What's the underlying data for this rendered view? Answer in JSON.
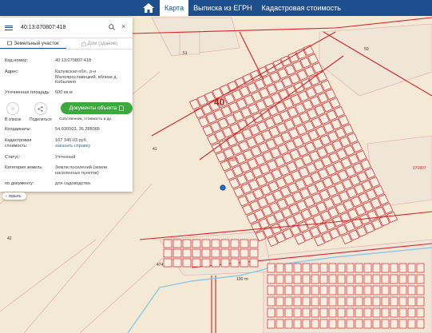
{
  "nav": {
    "items": [
      {
        "label": "Карта",
        "active": true
      },
      {
        "label": "Выписка из ЕГРН",
        "active": false
      },
      {
        "label": "Кадастровая стоимость",
        "active": false
      }
    ]
  },
  "search": {
    "value": "40:13:070807:418"
  },
  "tabs": [
    {
      "label": "Земельный участок",
      "active": true
    },
    {
      "label": "Дом (здание)",
      "active": false
    }
  ],
  "details": {
    "cad_number_label": "Кад.номер:",
    "cad_number_value": "40:13:070807:418",
    "address_label": "Адрес:",
    "address_line1": "Калужская обл., р-н",
    "address_line2": "Малоярославецкий, вблизи д.",
    "address_line3": "Кобылино",
    "area_label": "Уточненная площадь:",
    "area_value": "600 кв.м",
    "coords_label": "Координаты:",
    "coords_value": "54.930503, 36.288065",
    "cost_label1": "Кадастровая",
    "cost_label2": "стоимость:",
    "cost_value": "107 340.03 руб.",
    "cost_link": "заказать справку",
    "status_label": "Статус:",
    "status_value": "Учтенный",
    "category_label": "Категория земель:",
    "category_line1": "Земли поселений (земли",
    "category_line2": "населенных пунктов)",
    "usage_label": "по документу:",
    "usage_value": "для садоводства"
  },
  "actions": {
    "favorite": "В список",
    "share": "Поделиться",
    "doc_button": "Документы объекта",
    "doc_sub": "Собственник, стоимость и др."
  },
  "hide_button": "скрыть",
  "map": {
    "big_label": "40",
    "labels": [
      "51",
      "41",
      "42",
      "474",
      "070807",
      "100 тп",
      "50"
    ],
    "colors": {
      "background": "#f4e9d4",
      "parcel_fill": "#efe6d8",
      "boundary": "#d8232a",
      "water": "#8ec8e8",
      "marker": "#1f6fd0"
    }
  }
}
